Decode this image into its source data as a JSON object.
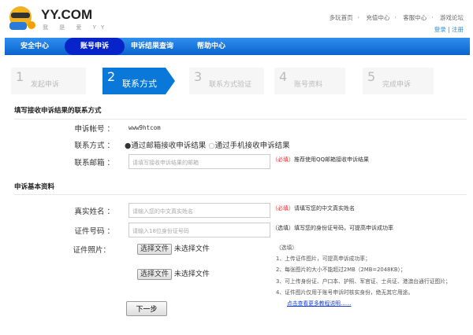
{
  "header": {
    "brand": "YY.COM",
    "slogan": "我 是 爱 YY",
    "links": [
      "多玩首页",
      "充值中心",
      "客服中心",
      "游戏论坛"
    ],
    "login": "登录",
    "register": "注册",
    "separator": "·"
  },
  "nav": [
    "安全中心",
    "账号申诉",
    "申诉结果查询",
    "帮助中心"
  ],
  "steps": [
    {
      "n": "1",
      "label": "发起申诉"
    },
    {
      "n": "2",
      "label": "联系方式"
    },
    {
      "n": "3",
      "label": "联系方式验证"
    },
    {
      "n": "4",
      "label": "账号资料"
    },
    {
      "n": "5",
      "label": "完成申诉"
    }
  ],
  "contact": {
    "title": "填写接收申诉结果的联系方式",
    "account_label": "申诉帐号 ：",
    "account": "www9htcom",
    "method_label": "联系方式 ：",
    "method_email": "通过邮箱接收申诉结果",
    "method_phone": "通过手机接收申诉结果",
    "email_label": "联系邮箱 ：",
    "email_placeholder": "请填写接收申诉结果的邮箱",
    "email_req": "（必填）",
    "email_hint": "推荐使用QQ邮箱接收申诉结果"
  },
  "basic": {
    "title": "申诉基本资料",
    "name_label": "真实姓名 ：",
    "name_placeholder": "请输入您的中文真实姓名",
    "name_req": "（必填）",
    "name_hint": "请填写您的中文真实姓名",
    "id_label": "证件号码 ：",
    "id_placeholder": "请输入18位身份证号码",
    "id_hint": "（选填）填写您的身份证号码，可提高申诉成功率",
    "photo_label": "证件照片：",
    "choose_file": "选择文件",
    "no_file": "未选择文件",
    "notes": [
      "（选填）",
      "1、上传证件图片，可提高申诉成功率；",
      "2、每张图片的大小不能超过2MB（2MB=2048KB）；",
      "3、可上传身份证、户口本、护照、军官证、士兵证、港澳台通行证图片；",
      "4、证件图片仅用于账号申诉时核实身份，绝无其它用途。"
    ],
    "more_link": "点击查看更多教程说明……"
  },
  "next": "下一步"
}
